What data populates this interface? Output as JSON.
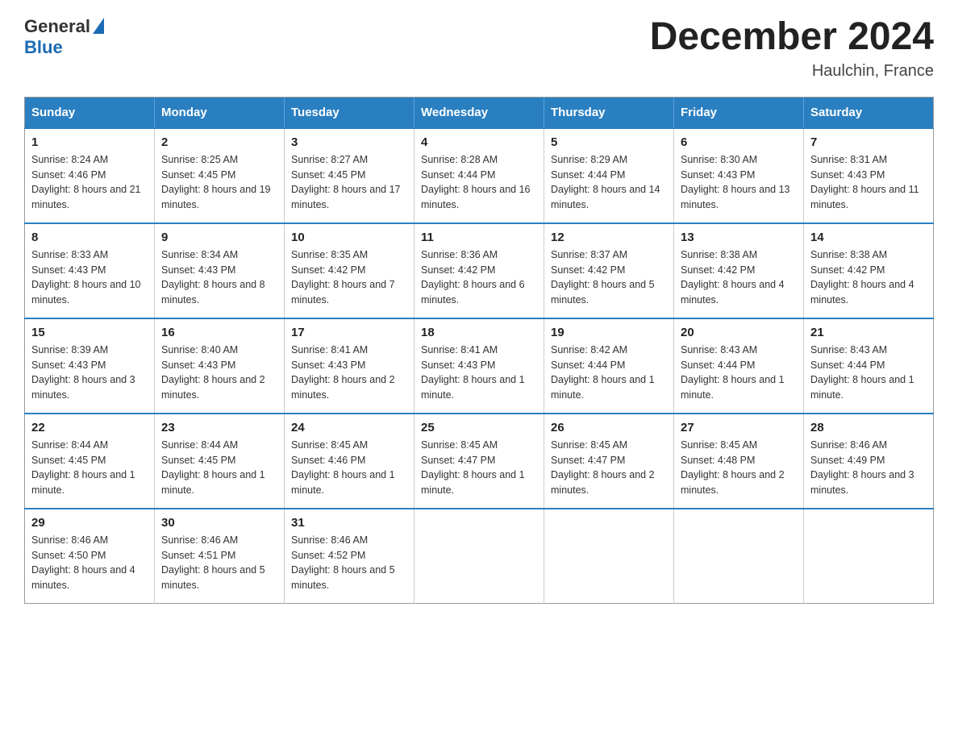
{
  "header": {
    "logo_general": "General",
    "logo_blue": "Blue",
    "title": "December 2024",
    "subtitle": "Haulchin, France"
  },
  "days_of_week": [
    "Sunday",
    "Monday",
    "Tuesday",
    "Wednesday",
    "Thursday",
    "Friday",
    "Saturday"
  ],
  "weeks": [
    [
      {
        "day": "1",
        "sunrise": "8:24 AM",
        "sunset": "4:46 PM",
        "daylight": "8 hours and 21 minutes."
      },
      {
        "day": "2",
        "sunrise": "8:25 AM",
        "sunset": "4:45 PM",
        "daylight": "8 hours and 19 minutes."
      },
      {
        "day": "3",
        "sunrise": "8:27 AM",
        "sunset": "4:45 PM",
        "daylight": "8 hours and 17 minutes."
      },
      {
        "day": "4",
        "sunrise": "8:28 AM",
        "sunset": "4:44 PM",
        "daylight": "8 hours and 16 minutes."
      },
      {
        "day": "5",
        "sunrise": "8:29 AM",
        "sunset": "4:44 PM",
        "daylight": "8 hours and 14 minutes."
      },
      {
        "day": "6",
        "sunrise": "8:30 AM",
        "sunset": "4:43 PM",
        "daylight": "8 hours and 13 minutes."
      },
      {
        "day": "7",
        "sunrise": "8:31 AM",
        "sunset": "4:43 PM",
        "daylight": "8 hours and 11 minutes."
      }
    ],
    [
      {
        "day": "8",
        "sunrise": "8:33 AM",
        "sunset": "4:43 PM",
        "daylight": "8 hours and 10 minutes."
      },
      {
        "day": "9",
        "sunrise": "8:34 AM",
        "sunset": "4:43 PM",
        "daylight": "8 hours and 8 minutes."
      },
      {
        "day": "10",
        "sunrise": "8:35 AM",
        "sunset": "4:42 PM",
        "daylight": "8 hours and 7 minutes."
      },
      {
        "day": "11",
        "sunrise": "8:36 AM",
        "sunset": "4:42 PM",
        "daylight": "8 hours and 6 minutes."
      },
      {
        "day": "12",
        "sunrise": "8:37 AM",
        "sunset": "4:42 PM",
        "daylight": "8 hours and 5 minutes."
      },
      {
        "day": "13",
        "sunrise": "8:38 AM",
        "sunset": "4:42 PM",
        "daylight": "8 hours and 4 minutes."
      },
      {
        "day": "14",
        "sunrise": "8:38 AM",
        "sunset": "4:42 PM",
        "daylight": "8 hours and 4 minutes."
      }
    ],
    [
      {
        "day": "15",
        "sunrise": "8:39 AM",
        "sunset": "4:43 PM",
        "daylight": "8 hours and 3 minutes."
      },
      {
        "day": "16",
        "sunrise": "8:40 AM",
        "sunset": "4:43 PM",
        "daylight": "8 hours and 2 minutes."
      },
      {
        "day": "17",
        "sunrise": "8:41 AM",
        "sunset": "4:43 PM",
        "daylight": "8 hours and 2 minutes."
      },
      {
        "day": "18",
        "sunrise": "8:41 AM",
        "sunset": "4:43 PM",
        "daylight": "8 hours and 1 minute."
      },
      {
        "day": "19",
        "sunrise": "8:42 AM",
        "sunset": "4:44 PM",
        "daylight": "8 hours and 1 minute."
      },
      {
        "day": "20",
        "sunrise": "8:43 AM",
        "sunset": "4:44 PM",
        "daylight": "8 hours and 1 minute."
      },
      {
        "day": "21",
        "sunrise": "8:43 AM",
        "sunset": "4:44 PM",
        "daylight": "8 hours and 1 minute."
      }
    ],
    [
      {
        "day": "22",
        "sunrise": "8:44 AM",
        "sunset": "4:45 PM",
        "daylight": "8 hours and 1 minute."
      },
      {
        "day": "23",
        "sunrise": "8:44 AM",
        "sunset": "4:45 PM",
        "daylight": "8 hours and 1 minute."
      },
      {
        "day": "24",
        "sunrise": "8:45 AM",
        "sunset": "4:46 PM",
        "daylight": "8 hours and 1 minute."
      },
      {
        "day": "25",
        "sunrise": "8:45 AM",
        "sunset": "4:47 PM",
        "daylight": "8 hours and 1 minute."
      },
      {
        "day": "26",
        "sunrise": "8:45 AM",
        "sunset": "4:47 PM",
        "daylight": "8 hours and 2 minutes."
      },
      {
        "day": "27",
        "sunrise": "8:45 AM",
        "sunset": "4:48 PM",
        "daylight": "8 hours and 2 minutes."
      },
      {
        "day": "28",
        "sunrise": "8:46 AM",
        "sunset": "4:49 PM",
        "daylight": "8 hours and 3 minutes."
      }
    ],
    [
      {
        "day": "29",
        "sunrise": "8:46 AM",
        "sunset": "4:50 PM",
        "daylight": "8 hours and 4 minutes."
      },
      {
        "day": "30",
        "sunrise": "8:46 AM",
        "sunset": "4:51 PM",
        "daylight": "8 hours and 5 minutes."
      },
      {
        "day": "31",
        "sunrise": "8:46 AM",
        "sunset": "4:52 PM",
        "daylight": "8 hours and 5 minutes."
      },
      null,
      null,
      null,
      null
    ]
  ],
  "labels": {
    "sunrise": "Sunrise:",
    "sunset": "Sunset:",
    "daylight": "Daylight:"
  }
}
